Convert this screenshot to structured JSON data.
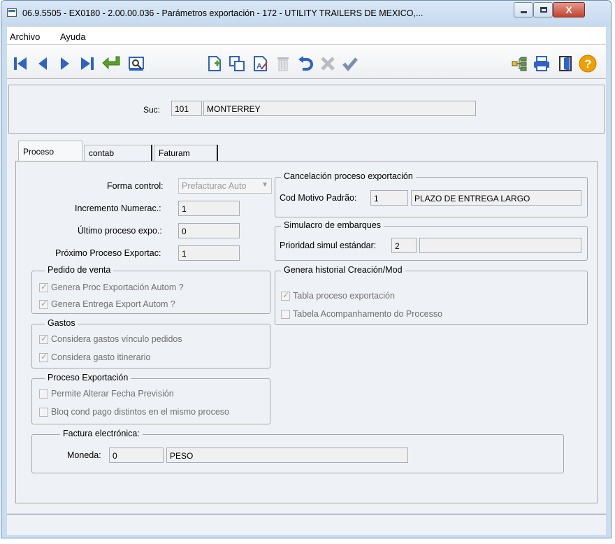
{
  "window": {
    "title": "06.9.5505 - EX0180 - 2.00.00.036 - Parámetros exportación - 172 - UTILITY TRAILERS DE MEXICO,...",
    "close_label": "X"
  },
  "menu": {
    "items": [
      "Archivo",
      "Ayuda"
    ]
  },
  "toolbar": {
    "icons": [
      "first-record-icon",
      "previous-record-icon",
      "next-record-icon",
      "last-record-icon",
      "goto-icon",
      "search-icon",
      "new-record-icon",
      "copy-icon",
      "edit-icon",
      "delete-icon",
      "undo-icon",
      "cancel-icon",
      "confirm-icon",
      "tree-icon",
      "print-icon",
      "exit-icon",
      "help-icon"
    ]
  },
  "header": {
    "suc_label": "Suc:",
    "suc_code": "101",
    "suc_name": "MONTERREY"
  },
  "tabs": [
    "Proceso",
    "contab",
    "Faturam"
  ],
  "proceso": {
    "forma_control_label": "Forma control:",
    "forma_control_value": "Prefacturac Auto",
    "incremento_label": "Incremento Numerac.:",
    "incremento_value": "1",
    "ultimo_label": "Último proceso expo.:",
    "ultimo_value": "0",
    "proximo_label": "Próximo Proceso Exportac:",
    "proximo_value": "1",
    "pedido_group": "Pedido de venta",
    "pedido_opts": [
      "Genera Proc Exportación Autom ?",
      "Genera Entrega Export Autom ?"
    ],
    "gastos_group": "Gastos",
    "gastos_opts": [
      "Considera gastos vínculo pedidos",
      "Considera gasto itinerario"
    ],
    "proc_exp_group": "Proceso Exportación",
    "proc_exp_opts": [
      "Permite Alterar Fecha Previsión",
      "Bloq cond pago distintos en el mismo proceso"
    ],
    "cancel_group": "Cancelación proceso exportación",
    "cod_motivo_label": "Cod Motivo Padrão:",
    "cod_motivo_value": "1",
    "cod_motivo_desc": "PLAZO DE ENTREGA LARGO",
    "simulacro_group": "Simulacro de embarques",
    "prioridad_label": "Prioridad simul estándar:",
    "prioridad_value": "2",
    "prioridad_desc": "",
    "historial_group": "Genera historial Creación/Mod",
    "historial_opts": [
      "Tabla proceso exportación",
      "Tabela Acompanhamento do Processo"
    ],
    "factura_group": "Factura electrónica:",
    "moneda_label": "Moneda:",
    "moneda_value": "0",
    "moneda_desc": "PESO"
  },
  "checkbox_states": {
    "pedido": [
      true,
      true
    ],
    "gastos": [
      true,
      true
    ],
    "proc_exp": [
      false,
      false
    ],
    "historial": [
      true,
      false
    ]
  },
  "colors": {
    "nav_blue": "#2e63c7",
    "green_arrow": "#5aa02c",
    "help_orange": "#f0a000"
  }
}
